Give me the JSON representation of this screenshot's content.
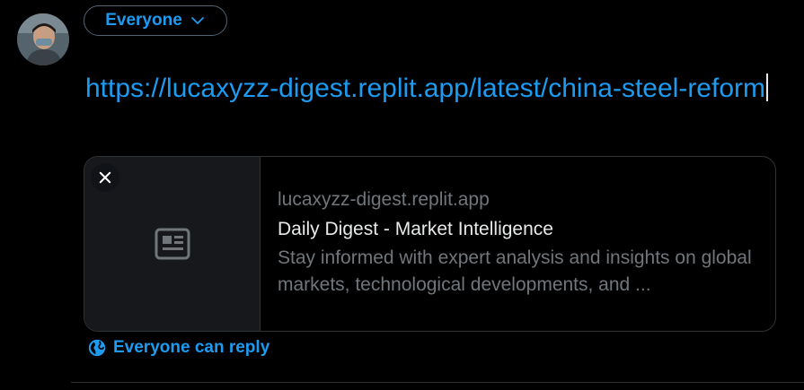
{
  "composer": {
    "audience_label": "Everyone",
    "text": "https://lucaxyzz-digest.replit.app/latest/china-steel-reform"
  },
  "link_card": {
    "domain": "lucaxyzz-digest.replit.app",
    "title": "Daily Digest - Market Intelligence",
    "description": "Stay informed with expert analysis and insights on global markets, technological developments, and ..."
  },
  "reply_setting": {
    "label": "Everyone can reply"
  },
  "colors": {
    "accent": "#1d9bf0",
    "background": "#000000",
    "border": "#2f3336",
    "muted_text": "#71767b",
    "primary_text": "#e7e9ea"
  },
  "icons": {
    "audience": "chevron-down-icon",
    "card_close": "close-icon",
    "card_placeholder": "newspaper-icon",
    "reply": "globe-icon"
  }
}
